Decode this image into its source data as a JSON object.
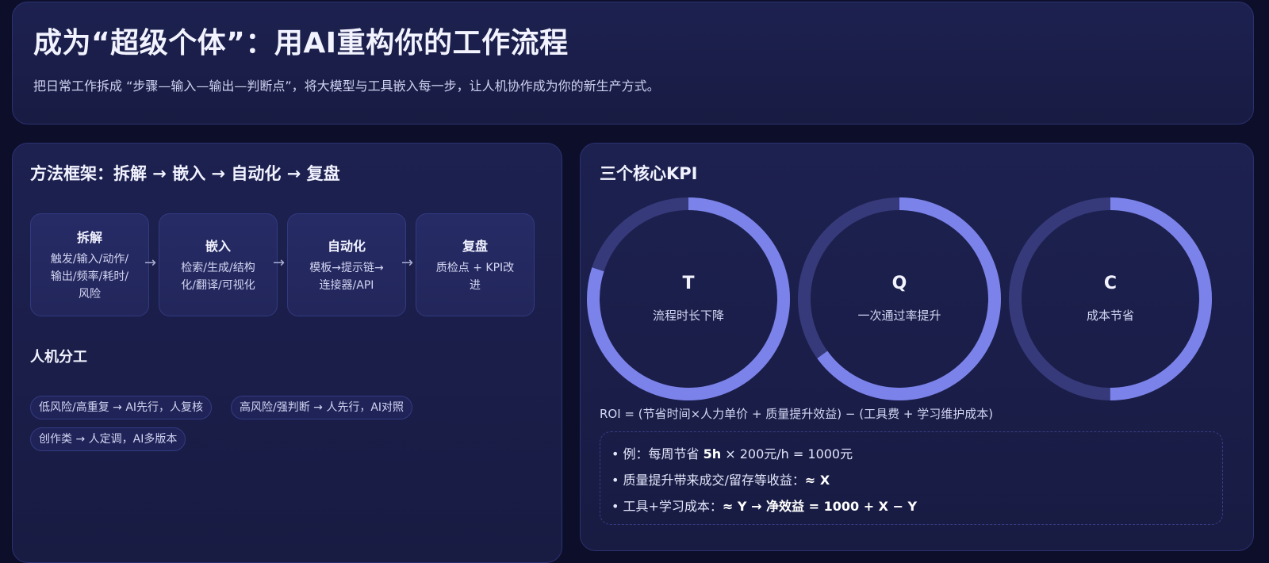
{
  "header": {
    "title": "成为“超级个体”：用AI重构你的工作流程",
    "subtitle": "把日常工作拆成 “步骤—输入—输出—判断点”，将大模型与工具嵌入每一步，让人机协作成为你的新生产方式。"
  },
  "method": {
    "title": "方法框架：拆解 → 嵌入 → 自动化 → 复盘",
    "steps": [
      {
        "title": "拆解",
        "desc_lines": [
          "触发/输入/动作/",
          "输出/频率/耗时/",
          "风险"
        ]
      },
      {
        "title": "嵌入",
        "desc_lines": [
          "检索/生成/结构",
          "化/翻译/可视化"
        ]
      },
      {
        "title": "自动化",
        "desc_lines": [
          "模板→提示链→",
          "连接器/API"
        ]
      },
      {
        "title": "复盘",
        "desc_lines": [
          "质检点 + KPI改",
          "进"
        ]
      }
    ],
    "arrow": "→"
  },
  "division": {
    "title": "人机分工",
    "tags": [
      "低风险/高重复 → AI先行，人复核",
      "高风险/强判断 → 人先行，AI对照",
      "创作类 → 人定调，AI多版本"
    ]
  },
  "kpi": {
    "title": "三个核心KPI",
    "rings": [
      {
        "letter": "T",
        "label": "流程时长下降",
        "progress": 0.8
      },
      {
        "letter": "Q",
        "label": "一次通过率提升",
        "progress": 0.65
      },
      {
        "letter": "C",
        "label": "成本节省",
        "progress": 0.5
      }
    ],
    "roi_formula": "ROI = (节省时间×人力单价 + 质量提升效益) − (工具费 + 学习维护成本)",
    "examples": {
      "line1_prefix": "• 例：每周节省 ",
      "line1_bold": "5h",
      "line1_suffix": " × 200元/h = 1000元",
      "line2_prefix": "• 质量提升带来成交/留存等收益：",
      "line2_bold": "≈ X",
      "line3_prefix": "• 工具+学习成本：",
      "line3_bold": "≈ Y → 净效益 = 1000 + X − Y"
    }
  },
  "colors": {
    "ring_track": "#363a7a",
    "ring_fill": "#7b83ea",
    "background": "#0d0f2a"
  }
}
